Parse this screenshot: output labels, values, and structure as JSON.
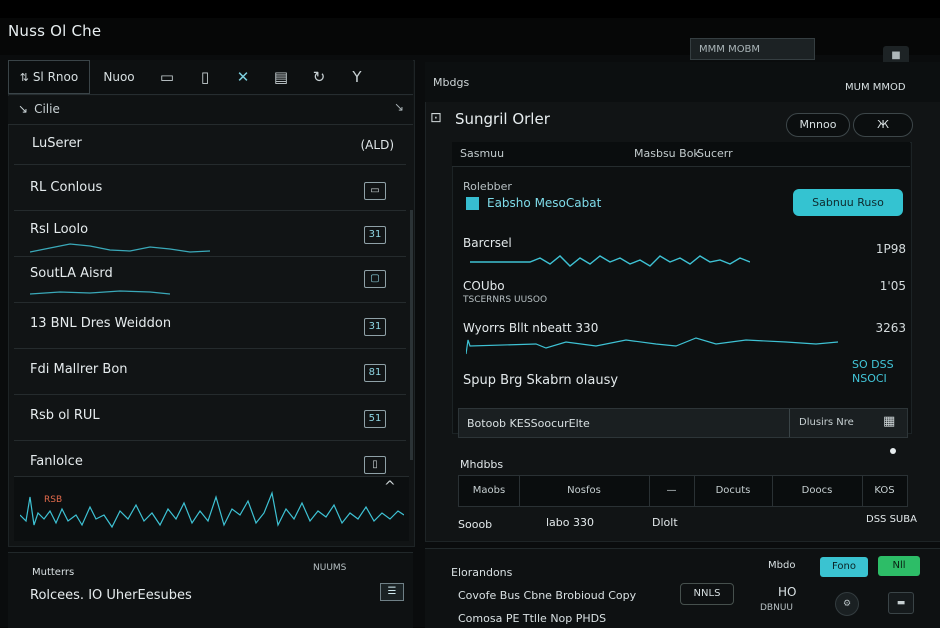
{
  "app": {
    "title": "Nuss Ol Che"
  },
  "topbar": {
    "search_placeholder": "MMM MOBM",
    "window_btn": "■"
  },
  "left": {
    "toolbar": {
      "first": "Sl Rnoo",
      "label": "Nuoo",
      "icons": [
        "square-icon",
        "file-icon",
        "link-icon",
        "document-icon",
        "refresh-icon",
        "filter-icon"
      ]
    },
    "section_header": {
      "title": "Cilie",
      "right": "↘"
    },
    "rows": [
      {
        "label": "LuSerer",
        "icon": "(ALD)"
      },
      {
        "label": "RL Conlous",
        "icon": "▭"
      },
      {
        "label": "Rsl Loolo",
        "icon": "31"
      },
      {
        "label": "SoutLA Aisrd",
        "icon": "▢"
      },
      {
        "label": "13 BNL Dres Weiddon",
        "icon": "31"
      },
      {
        "label": "Fdi Mallrer Bon",
        "icon": "81"
      },
      {
        "label": "Rsb ol RUL",
        "icon": "51"
      },
      {
        "label": "Fanlolce",
        "icon": "▯"
      }
    ],
    "waveform": {
      "label": "RSB",
      "arrow": "^"
    },
    "lower": {
      "label": "Mutterrs",
      "right": "NUUMS",
      "entry": "Rolcees. IO UherEesubes",
      "entry_icon": "☰"
    }
  },
  "right": {
    "header": {
      "label": "Mbdgs",
      "right": "MUM MMOD"
    },
    "main": {
      "title": "Sungril Orler",
      "btn1": "Mnnoo",
      "btn2": "Ж"
    },
    "tabs": {
      "tab1": "Sasmuu",
      "tab2": "Masbsu Bok",
      "tab3": "Sucerr"
    },
    "subrow": {
      "label": "Rolebber",
      "checkbox_label": "Eabsho MesoCabat",
      "accent": "Sabnuu Ruso"
    },
    "lines": [
      {
        "name": "Barcrsel",
        "value": "1P98"
      },
      {
        "name": "COUbo",
        "sub": "TSCERNRS UUSOO",
        "value": "1'05"
      },
      {
        "name": "Wyorrs Bllt nbeatt 330",
        "value": "3263"
      },
      {
        "name": "Spup Brg Skabrn olausy",
        "value2": "SO DSS",
        "value3": "NSOCI"
      }
    ],
    "status": {
      "text": "Botoob KESSoocurElte",
      "right": "Dlusirs Nre",
      "icon": "▦"
    },
    "below": {
      "label": "Mhdbbs"
    },
    "table": {
      "cells": [
        "Maobs",
        "Nosfos",
        "—",
        "Docuts",
        "Doocs",
        "KOS"
      ]
    },
    "totals": {
      "left": "Sooob",
      "mid": "labo 330",
      "right": "Dlolt",
      "far": "DSS SUBA"
    }
  },
  "bottom": {
    "label": "Elorandons",
    "btn_teal": "Fono",
    "btn_green": "Nll",
    "mid_label": "Mbdo",
    "row1": "Covofe Bus Cbne Brobioud Copy",
    "chip": "NNLS",
    "row2": "Comosa PE Ttlle Nop PHDS",
    "right_small": "HO",
    "right_small2": "DBNUU"
  }
}
